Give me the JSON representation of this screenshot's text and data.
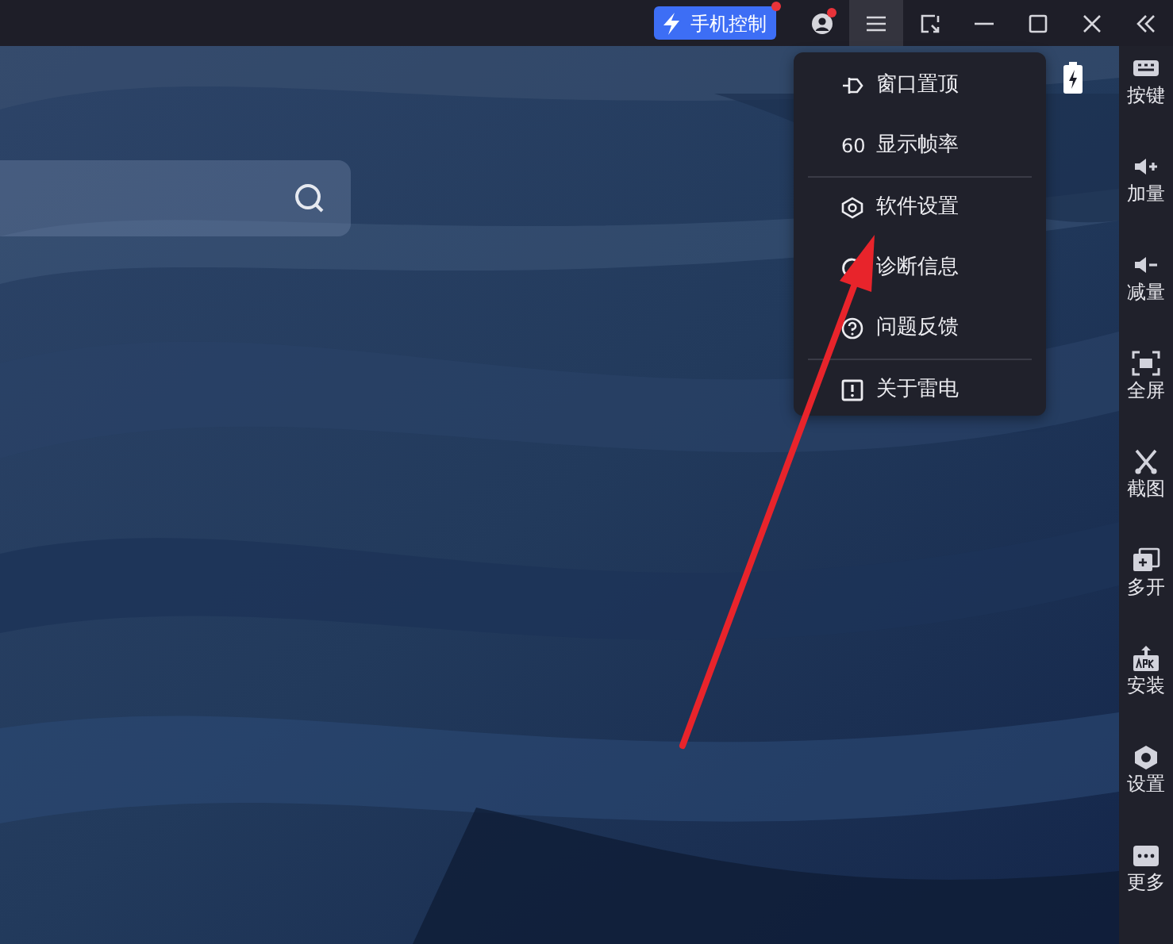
{
  "titlebar": {
    "phone_button": {
      "label": "手机控制",
      "badge": true
    },
    "account": {
      "badge": true
    },
    "menu_button": {
      "selected": true
    },
    "controls": [
      {
        "kind": "screenshot"
      },
      {
        "kind": "minimize"
      },
      {
        "kind": "maximize"
      },
      {
        "kind": "close"
      },
      {
        "kind": "collapse"
      }
    ]
  },
  "menu": {
    "groups": [
      [
        {
          "kind": "pin",
          "label": "窗口置顶"
        },
        {
          "kind": "fps",
          "icon_text": "60",
          "label": "显示帧率"
        }
      ],
      [
        {
          "kind": "settings",
          "label": "软件设置"
        },
        {
          "kind": "diagnostic",
          "label": "诊断信息"
        },
        {
          "kind": "help",
          "label": "问题反馈"
        }
      ],
      [
        {
          "kind": "about",
          "label": "关于雷电"
        }
      ]
    ]
  },
  "search": {
    "kind": "search"
  },
  "toolbar": [
    {
      "kind": "keys",
      "label": "按键"
    },
    {
      "kind": "vol_up",
      "label": "加量"
    },
    {
      "kind": "vol_down",
      "label": "减量"
    },
    {
      "kind": "fullscreen",
      "label": "全屏"
    },
    {
      "kind": "scissors",
      "label": "截图"
    },
    {
      "kind": "multi",
      "label": "多开"
    },
    {
      "kind": "apk",
      "label": "安装"
    },
    {
      "kind": "gear",
      "label": "设置"
    },
    {
      "kind": "more",
      "label": "更多"
    }
  ],
  "annotation": {
    "kind": "arrow"
  }
}
